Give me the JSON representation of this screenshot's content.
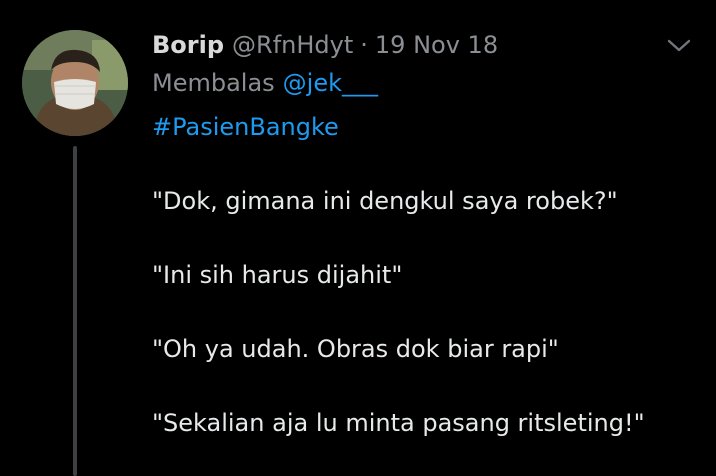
{
  "tweet": {
    "author_name": "Borip",
    "author_handle": "@RfnHdyt",
    "separator": "·",
    "date": "19 Nov 18",
    "reply_prefix": "Membalas",
    "reply_mention": "@jek___",
    "hashtag": "#PasienBangke",
    "lines": [
      "\"Dok, gimana ini dengkul saya robek?\"",
      "\"Ini sih harus dijahit\"",
      "\"Oh ya udah. Obras dok biar rapi\"",
      "\"Sekalian aja lu minta pasang ritsleting!\""
    ]
  },
  "icons": {
    "menu": "chevron-down-icon"
  },
  "colors": {
    "background": "#000000",
    "text": "#e7e9ea",
    "muted": "#8b8f94",
    "link": "#1d9bf0",
    "thread_line": "#3d4045"
  }
}
